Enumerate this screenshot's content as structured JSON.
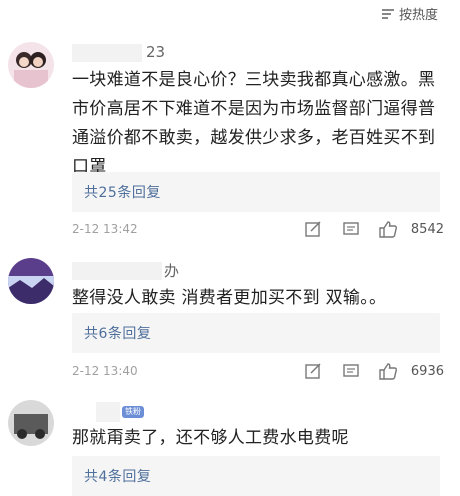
{
  "sort": {
    "label": "按热度"
  },
  "comments": [
    {
      "username": "23",
      "text": "一块难道不是良心价？三块卖我都真心感激。黑市价高居不下难道不是因为市场监督部门逼得普通溢价都不敢卖，越发供少求多，老百姓买不到口罩",
      "replies": "共25条回复",
      "time": "2-12 13:42",
      "likes": "8542"
    },
    {
      "username": "办",
      "text": "整得没人敢卖 消费者更加买不到 双输。。",
      "replies": "共6条回复",
      "time": "2-12 13:40",
      "likes": "6936"
    },
    {
      "username": "",
      "badge": "铁粉",
      "text": "那就甭卖了，还不够人工费水电费呢",
      "replies": "共4条回复"
    }
  ]
}
